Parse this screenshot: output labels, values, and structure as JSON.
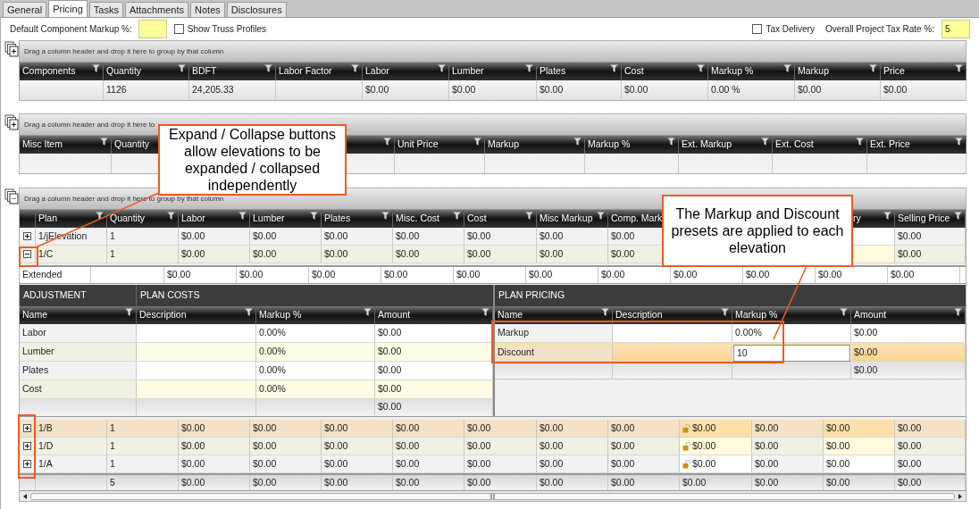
{
  "tabs": [
    {
      "label": "General",
      "selected": false
    },
    {
      "label": "Pricing",
      "selected": true
    },
    {
      "label": "Tasks",
      "selected": false
    },
    {
      "label": "Attachments",
      "selected": false
    },
    {
      "label": "Notes",
      "selected": false
    },
    {
      "label": "Disclosures",
      "selected": false
    }
  ],
  "settings": {
    "markup_label": "Default Component Markup %:",
    "show_truss": {
      "label": "Show Truss Profiles",
      "checked": false
    },
    "tax_delivery": {
      "label": "Tax Delivery",
      "checked": false
    },
    "tax_rate_label": "Overall Project Tax Rate %:",
    "tax_rate_value": "5"
  },
  "components_grid": {
    "group_hint": "Drag a column header and drop it here to group by that column",
    "columns": [
      "Components",
      "Quantity",
      "BDFT",
      "Labor Factor",
      "Labor",
      "Lumber",
      "Plates",
      "Cost",
      "Markup %",
      "Markup",
      "Price"
    ],
    "rows": [
      [
        null,
        "1126",
        "24,205.33",
        null,
        "$0.00",
        "$0.00",
        "$0.00",
        "$0.00",
        "0.00 %",
        "$0.00",
        "$0.00"
      ]
    ]
  },
  "misc_grid": {
    "group_hint": "Drag a column header and drop it here to",
    "columns": [
      "Misc Item",
      "Quantity",
      null,
      null,
      "Unit Price",
      "Markup",
      "Markup %",
      "Ext. Markup",
      "Ext. Cost",
      "Ext. Price"
    ]
  },
  "plans_grid": {
    "group_hint": "Drag a column header and drop it here to group by that column",
    "columns": [
      "Plan",
      "Quantity",
      "Labor",
      "Lumber",
      "Plates",
      "Misc. Cost",
      "Cost",
      "Misc Markup",
      "Comp. Mark",
      null,
      null,
      "ry",
      "Selling Price"
    ],
    "rows": [
      {
        "expanded": false,
        "selected": false,
        "locked": false,
        "cells": [
          "1/jElevation",
          "1",
          "$0.00",
          "$0.00",
          "$0.00",
          "$0.00",
          "$0.00",
          "$0.00",
          "$0.00",
          null,
          null,
          null,
          "$0.00"
        ]
      },
      {
        "expanded": true,
        "selected": false,
        "locked": false,
        "cells": [
          "1/C",
          "1",
          "$0.00",
          "$0.00",
          "$0.00",
          "$0.00",
          "$0.00",
          "$0.00",
          "$0.00",
          null,
          null,
          null,
          "$0.00"
        ]
      }
    ],
    "extended": {
      "label": "Extended",
      "values": [
        "$0.00",
        "$0.00",
        "$0.00",
        "$0.00",
        "$0.00",
        "$0.00",
        "$0.00",
        "$0.00",
        "$0.00",
        "$0.00",
        "$0.00"
      ]
    },
    "adjustment": {
      "title": "ADJUSTMENT",
      "costs_title": "PLAN COSTS",
      "pricing_title": "PLAN PRICING",
      "cost_columns": [
        "Name",
        "Description",
        "Markup %",
        "Amount"
      ],
      "cost_rows": [
        {
          "name": "Labor",
          "markup": "0.00%",
          "amount": "$0.00"
        },
        {
          "name": "Lumber",
          "markup": "0.00%",
          "amount": "$0.00"
        },
        {
          "name": "Plates",
          "markup": "0.00%",
          "amount": "$0.00"
        },
        {
          "name": "Cost",
          "markup": "0.00%",
          "amount": "$0.00"
        }
      ],
      "cost_total": "$0.00",
      "pricing_columns": [
        "Name",
        "Description",
        "Markup %",
        "Amount"
      ],
      "pricing_rows": [
        {
          "name": "Markup",
          "markup": "0.00%",
          "amount": "$0.00",
          "selected": false,
          "editing": false
        },
        {
          "name": "Discount",
          "markup": "10",
          "amount": "$0.00",
          "selected": true,
          "editing": true
        }
      ],
      "pricing_total": "$0.00"
    },
    "more_rows": [
      {
        "expanded": false,
        "selected": true,
        "locked": true,
        "cells": [
          "1/B",
          "1",
          "$0.00",
          "$0.00",
          "$0.00",
          "$0.00",
          "$0.00",
          "$0.00",
          "$0.00",
          "$0.00",
          "$0.00",
          "$0.00",
          "$0.00"
        ]
      },
      {
        "expanded": false,
        "selected": false,
        "locked": true,
        "cells": [
          "1/D",
          "1",
          "$0.00",
          "$0.00",
          "$0.00",
          "$0.00",
          "$0.00",
          "$0.00",
          "$0.00",
          "$0.00",
          "$0.00",
          "$0.00",
          "$0.00"
        ]
      },
      {
        "expanded": false,
        "selected": false,
        "locked": true,
        "cells": [
          "1/A",
          "1",
          "$0.00",
          "$0.00",
          "$0.00",
          "$0.00",
          "$0.00",
          "$0.00",
          "$0.00",
          "$0.00",
          "$0.00",
          "$0.00",
          "$0.00"
        ]
      }
    ],
    "totals": {
      "quantity": "5",
      "values": [
        "$0.00",
        "$0.00",
        "$0.00",
        "$0.00",
        "$0.00",
        "$0.00",
        "$0.00",
        "$0.00",
        "$0.00",
        "$0.00",
        "$0.00"
      ]
    }
  },
  "callouts": [
    {
      "text": "Expand / Collapse buttons allow elevations to be expanded / collapsed independently"
    },
    {
      "text": "The Markup and Discount presets are applied to each elevation"
    }
  ]
}
